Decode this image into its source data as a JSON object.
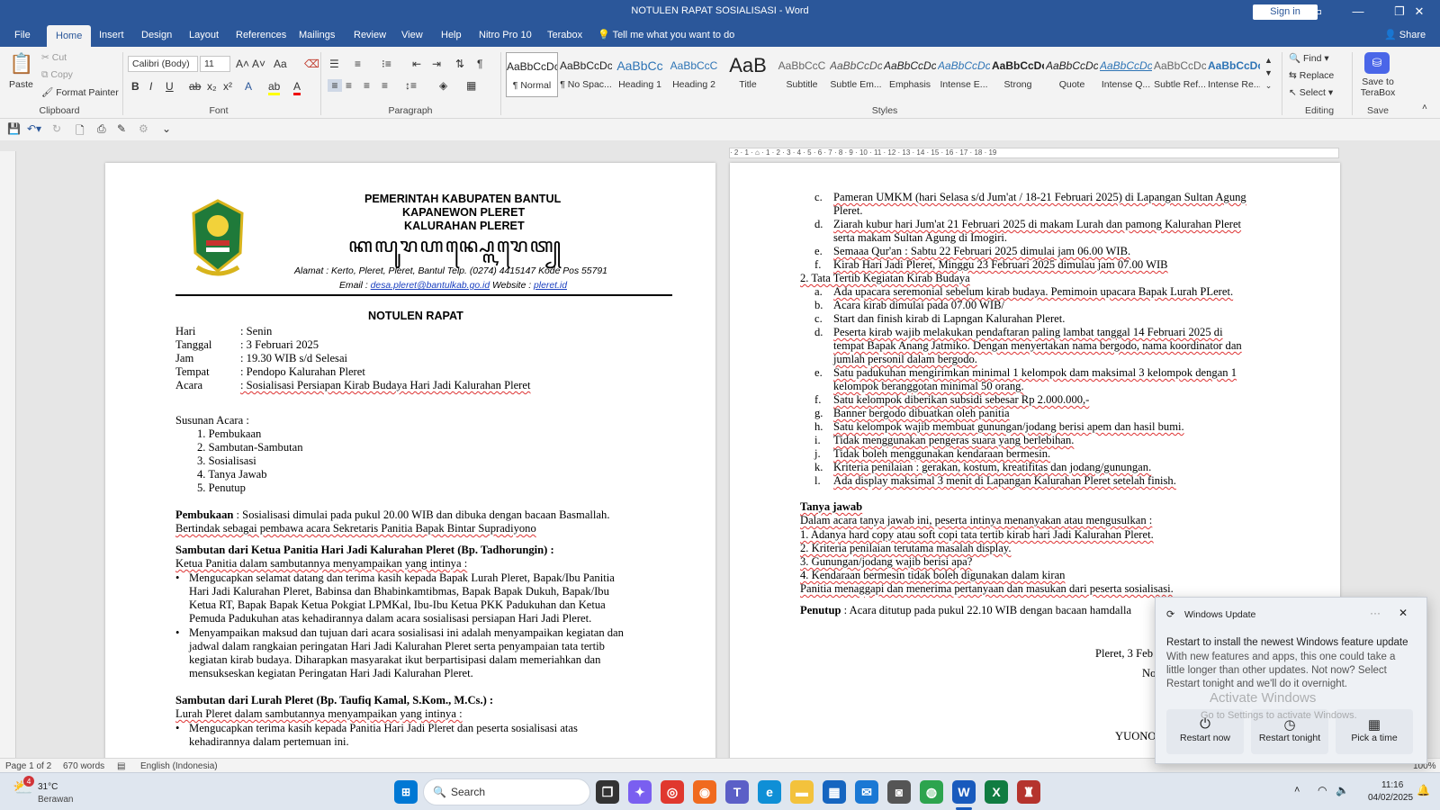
{
  "window": {
    "title": "NOTULEN RAPAT SOSIALISASI  -  Word",
    "signin": "Sign in"
  },
  "menu": {
    "tabs": [
      "File",
      "Home",
      "Insert",
      "Design",
      "Layout",
      "References",
      "Mailings",
      "Review",
      "View",
      "Help",
      "Nitro Pro 10",
      "Terabox"
    ],
    "active": "Home",
    "tellme": "Tell me what you want to do",
    "share": "Share"
  },
  "ribbon": {
    "clipboard": {
      "paste": "Paste",
      "cut": "Cut",
      "copy": "Copy",
      "format_painter": "Format Painter",
      "label": "Clipboard"
    },
    "font": {
      "name": "Calibri (Body)",
      "size": "11",
      "label": "Font"
    },
    "paragraph": {
      "label": "Paragraph"
    },
    "styles": {
      "items": [
        {
          "preview": "AaBbCcDc",
          "name": "¶ Normal"
        },
        {
          "preview": "AaBbCcDc",
          "name": "¶ No Spac..."
        },
        {
          "preview": "AaBbCc",
          "name": "Heading 1"
        },
        {
          "preview": "AaBbCcC",
          "name": "Heading 2"
        },
        {
          "preview": "AaB",
          "name": "Title"
        },
        {
          "preview": "AaBbCcC",
          "name": "Subtitle"
        },
        {
          "preview": "AaBbCcDc",
          "name": "Subtle Em..."
        },
        {
          "preview": "AaBbCcDc",
          "name": "Emphasis"
        },
        {
          "preview": "AaBbCcDc",
          "name": "Intense E..."
        },
        {
          "preview": "AaBbCcDc",
          "name": "Strong"
        },
        {
          "preview": "AaBbCcDc",
          "name": "Quote"
        },
        {
          "preview": "AaBbCcDc",
          "name": "Intense Q..."
        },
        {
          "preview": "AaBbCcDc",
          "name": "Subtle Ref..."
        },
        {
          "preview": "AaBbCcDc",
          "name": "Intense Re..."
        }
      ],
      "label": "Styles"
    },
    "editing": {
      "find": "Find",
      "replace": "Replace",
      "select": "Select",
      "label": "Editing"
    },
    "save": {
      "button": "Save to TeraBox",
      "label": "Save"
    }
  },
  "page1": {
    "header": {
      "line1": "PEMERINTAH KABUPATEN BANTUL",
      "line2": "KAPANEWON PLERET",
      "line3": "KALURAHAN PLERET",
      "javanese": "ꦏꦭꦸꦫꦲꦤ꧀ꦥ꧀ꦭꦺꦫꦺꦠ꧀",
      "address": "Alamat : Kerto, Pleret, Pleret, Bantul Telp. (0274) 4415147 Kode Pos 55791",
      "email_label": "Email :",
      "email": "desa.pleret@bantulkab.go.id",
      "website_label": "Website :",
      "website": "pleret.id"
    },
    "doc_title": "NOTULEN RAPAT",
    "info": [
      {
        "k": "Hari",
        "v": ": Senin"
      },
      {
        "k": "Tanggal",
        "v": ": 3 Februari 2025"
      },
      {
        "k": "Jam",
        "v": ": 19.30 WIB s/d Selesai"
      },
      {
        "k": "Tempat",
        "v": ": Pendopo Kalurahan Pleret"
      },
      {
        "k": "Acara",
        "v": ": Sosialisasi Persiapan Kirab Budaya Hari Jadi Kalurahan Pleret"
      }
    ],
    "agenda_title": "Susunan Acara :",
    "agenda": [
      "1.   Pembukaan",
      "2.   Sambutan-Sambutan",
      "3.   Sosialisasi",
      "4.   Tanya Jawab",
      "5.   Penutup"
    ],
    "pembukaan_label": "Pembukaan",
    "pembukaan_1": " : Sosialisasi dimulai pada pukul 20.00 WIB dan dibuka dengan bacaan Basmallah.",
    "pembukaan_2": "Bertindak sebagai pembawa acara Sekretaris Panitia Bapak Bintar Supradiyono",
    "ketua_head": "Sambutan dari Ketua Panitia Hari Jadi Kalurahan Pleret (Bp. Tadhorungin) :",
    "ketua_intro": "Ketua Panitia dalam sambutannya menyampaikan yang intinya :",
    "ketua_b1": [
      "Mengucapkan selamat datang dan terima kasih kepada Bapak Lurah Pleret, Bapak/Ibu Panitia",
      "Hari Jadi Kalurahan Pleret, Babinsa dan Bhabinkamtibmas, Bapak Bapak Dukuh, Bapak/Ibu",
      "Ketua RT, Bapak Bapak Ketua Pokgiat LPMKal, Ibu-Ibu Ketua PKK Padukuhan dan Ketua",
      "Pemuda Padukuhan atas kehadirannya dalam acara sosialisasi persiapan Hari Jadi Pleret."
    ],
    "ketua_b2": [
      "Menyampaikan maksud dan tujuan dari acara sosialisasi ini adalah menyampaikan kegiatan dan",
      "jadwal dalam rangkaian peringatan Hari Jadi Kalurahan Pleret serta penyampaian tata tertib",
      "kegiatan kirab budaya. Diharapkan masyarakat ikut berpartisipasi dalam memeriahkan dan",
      "mensukseskan kegiatan Peringatan Hari Jadi Kalurahan Pleret."
    ],
    "lurah_head": "Sambutan dari Lurah Pleret (Bp. Taufiq Kamal, S.Kom., M.Cs.) :",
    "lurah_intro": "Lurah Pleret dalam sambutannya menyampaikan yang intinya :",
    "lurah_b1": [
      "Mengucapkan terima kasih kepada Panitia Hari Jadi Pleret dan peserta sosialisasi atas",
      "kehadirannya dalam pertemuan ini."
    ]
  },
  "page2": {
    "ruler": "· 2 · 1 · ⌂ · 1 · 2 · 3 · 4 · 5 · 6 · 7 · 8 · 9 · 10 · 11 · 12 · 13 · 14 · 15 · 16 · 17 · 18 · 19",
    "list1": [
      {
        "m": "c.",
        "t": "Pameran UMKM (hari Selasa s/d Jum'at / 18-21 Februari 2025) di Lapangan Sultan Agung"
      },
      {
        "m": "",
        "t": "Pleret."
      },
      {
        "m": "d.",
        "t": "Ziarah kubur hari Jum'at 21 Februari 2025 di makam Lurah dan pamong Kalurahan Pleret"
      },
      {
        "m": "",
        "t": "serta makam Sultan Agung di Imogiri."
      },
      {
        "m": "e.",
        "t": "Semaaa Qur'an : Sabtu 22 Februari 2025 dimulai jam 06.00 WIB."
      },
      {
        "m": "f.",
        "t": "Kirab Hari Jadi Pleret, Minggu 23 Februari 2025 dimulau jam 07.00 WIB"
      }
    ],
    "sec2": "2.  Tata Tertib Kegiatan Kirab Budaya",
    "list2": [
      {
        "m": "a.",
        "t": "Ada upacara seremonial sebelum kirab budaya. Pemimoin upacara Bapak Lurah PLeret."
      },
      {
        "m": "b.",
        "t": "Acara kirab dimulai pada 07.00 WIB/"
      },
      {
        "m": "c.",
        "t": "Start dan finish kirab di Lapngan Kalurahan Pleret."
      },
      {
        "m": "d.",
        "t": "Peserta kirab wajib melakukan pendaftaran paling lambat tanggal 14 Februari 2025 di"
      },
      {
        "m": "",
        "t": "tempat Bapak Anang Jatmiko. Dengan menyertakan nama bergodo, nama koordinator dan"
      },
      {
        "m": "",
        "t": "jumlah personil dalam bergodo."
      },
      {
        "m": "e.",
        "t": "Satu padukuhan mengirimkan minimal 1 kelompok dam maksimal 3 kelompok dengan  1"
      },
      {
        "m": "",
        "t": "kelompok beranggotan minimal 50 orang."
      },
      {
        "m": "f.",
        "t": "Satu kelompok diberikan subsidi sebesar Rp 2.000.000,-"
      },
      {
        "m": "g.",
        "t": "Banner bergodo dibuatkan oleh panitia"
      },
      {
        "m": "h.",
        "t": "Satu kelompok wajib membuat gunungan/jodang berisi apem dan hasil bumi."
      },
      {
        "m": "i.",
        "t": "Tidak menggunakan pengeras suara yang berlebihan."
      },
      {
        "m": "j.",
        "t": "Tidak boleh menggunakan kendaraan bermesin."
      },
      {
        "m": "k.",
        "t": "Kriteria penilaian : gerakan, kostum, kreatifitas dan jodang/gunungan."
      },
      {
        "m": "l.",
        "t": "Ada display maksimal 3 menit di Lapangan Kalurahan Pleret setelah finish."
      }
    ],
    "tanya_head": "Tanya jawab",
    "tanya_intro": "Dalam acara tanya jawab ini, peserta intinya menanyakan atau mengusulkan :",
    "tanya": [
      "1.  Adanya hard copy atau soft copi tata tertib kirab hari Jadi Kalurahan Pleret.",
      "2.  Kriteria penilaian terutama masalah display.",
      "3.  Gunungan/jodang wajib berisi apa?",
      "4.  Kendaraan bermesin tidak boleh digunakan dalam kiran"
    ],
    "tanya_close": "Panitia menaggapi dan menerima pertanyaan dan masukan dari peserta sosialisasi.",
    "penutup_label": "Penutup",
    "penutup": " : Acara ditutup pada pukul 22.10  WIB dengan bacaan hamdalla",
    "sign_place": "Pleret, 3 Feb",
    "sign_no": "No",
    "sign_name": "YUONO"
  },
  "status": {
    "page": "Page 1 of 2",
    "words": "670 words",
    "lang": "English (Indonesia)",
    "zoom": "100%"
  },
  "toast": {
    "app": "Windows Update",
    "title": "Restart to install the newest Windows feature update",
    "body": [
      "With new features and apps, this one could take a",
      "little longer than other updates. Not now? Select",
      "Restart tonight and we'll do it overnight."
    ],
    "btn1": "Restart now",
    "btn2": "Restart tonight",
    "btn3": "Pick a time",
    "watermark1": "Activate Windows",
    "watermark2": "Go to Settings to activate Windows."
  },
  "taskbar": {
    "temp": "31°C",
    "weather": "Berawan",
    "badge": "4",
    "search": "Search",
    "time": "11:16",
    "date": "04/02/2025"
  }
}
